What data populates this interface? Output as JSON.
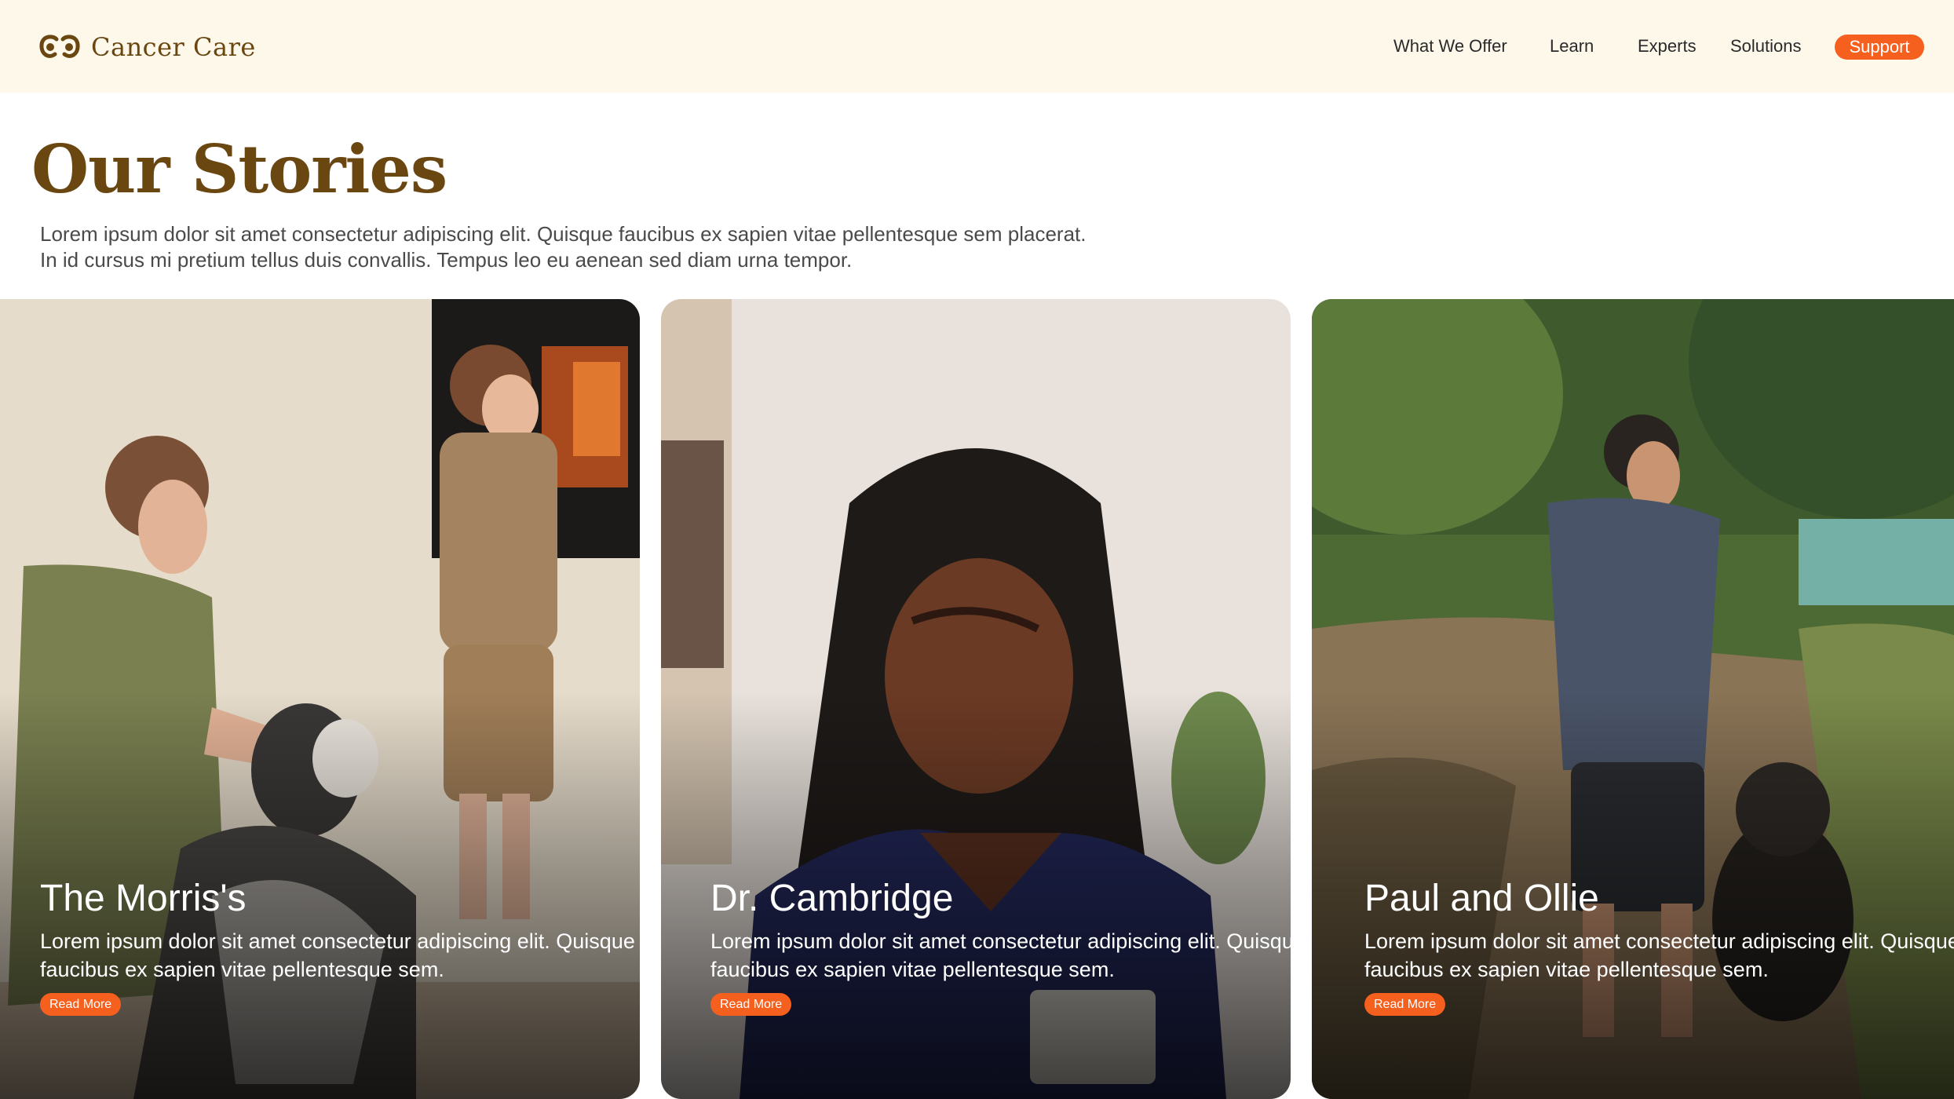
{
  "brand": {
    "logo_icon": "double-c-logo-icon",
    "name": "Cancer Care",
    "color": "#6a4611"
  },
  "nav": {
    "items": [
      "What We Offer",
      "Learn",
      "Experts",
      "Solutions"
    ],
    "support_label": "Support",
    "accent_color": "#f5601e"
  },
  "page": {
    "title": "Our Stories",
    "intro": "Lorem ipsum dolor sit amet consectetur adipiscing elit. Quisque faucibus ex sapien vitae pellentesque sem placerat. In id cursus mi pretium tellus duis convallis. Tempus leo eu aenean sed diam urna tempor."
  },
  "stories": [
    {
      "photo": "photo-mother-child-dog-kitchen",
      "title": "The Morris's",
      "text": "Lorem ipsum dolor sit amet consectetur adipiscing elit. Quisque faucibus ex sapien vitae pellentesque sem.",
      "button": "Read More"
    },
    {
      "photo": "photo-woman-braids-writing",
      "title": "Dr. Cambridge",
      "text": "Lorem ipsum dolor sit amet consectetur adipiscing elit. Quisque faucibus ex sapien vitae pellentesque sem.",
      "button": "Read More"
    },
    {
      "photo": "photo-hiker-with-dog-trail",
      "title": "Paul and Ollie",
      "text": "Lorem ipsum dolor sit amet consectetur adipiscing elit. Quisque faucibus ex sapien vitae pellentesque sem.",
      "button": "Read More"
    }
  ]
}
